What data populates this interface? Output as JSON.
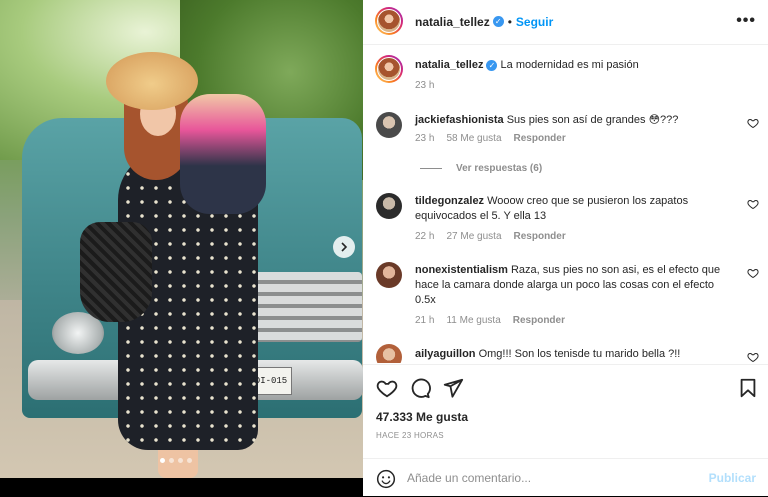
{
  "post": {
    "author": "natalia_tellez",
    "follow_label": "Seguir",
    "separator": "•",
    "more_label": "•••",
    "caption": "La modernidad es mi pasión",
    "caption_time": "23 h",
    "plate_text": "DI-015"
  },
  "comments": [
    {
      "user": "jackiefashionista",
      "text": "Sus pies son así de grandes 😳???",
      "time": "23 h",
      "likes": "58 Me gusta",
      "reply": "Responder",
      "view_replies": "Ver respuestas (6)"
    },
    {
      "user": "tildegonzalez",
      "text": "Wooow creo que se pusieron los zapatos equivocados el 5. Y ella 13",
      "time": "22 h",
      "likes": "27 Me gusta",
      "reply": "Responder"
    },
    {
      "user": "nonexistentialism",
      "text": "Raza, sus pies no son asi, es el efecto que hace la camara donde alarga un poco las cosas con el efecto 0.5x",
      "time": "21 h",
      "likes": "11 Me gusta",
      "reply": "Responder"
    },
    {
      "user": "ailyaguillon",
      "text": "Omg!!! Son los tenisde tu marido bella ?!!"
    }
  ],
  "stats": {
    "likes": "47.333 Me gusta",
    "time_ago": "HACE 23 HORAS"
  },
  "add_comment": {
    "placeholder": "Añade un comentario...",
    "publish_label": "Publicar"
  },
  "icons": {
    "like": "heart-icon",
    "comment": "comment-bubble-icon",
    "share": "paper-plane-icon",
    "save": "bookmark-icon",
    "emoji": "smiley-icon",
    "next": "chevron-right-icon",
    "verified": "verified-badge-icon"
  },
  "carousel": {
    "count": 4,
    "active_index": 0
  },
  "colors": {
    "accent": "#0095f6",
    "verified": "#3897f0",
    "muted_text": "#8e8e8e",
    "publish_disabled": "#b2dffc"
  }
}
